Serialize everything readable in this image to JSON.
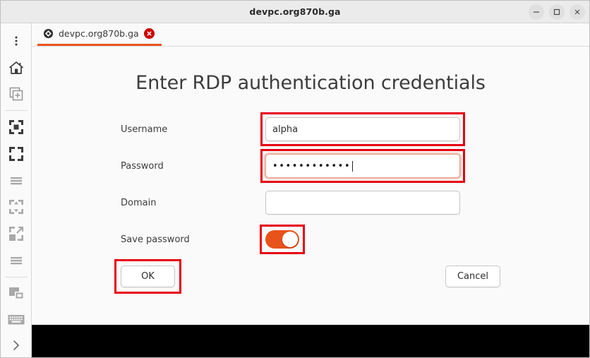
{
  "window": {
    "title": "devpc.org870b.ga",
    "controls": [
      {
        "name": "minimize",
        "glyph": "minimize-icon"
      },
      {
        "name": "maximize",
        "glyph": "maximize-icon"
      },
      {
        "name": "close",
        "glyph": "close-icon"
      }
    ]
  },
  "tabbar": {
    "tabs": [
      {
        "label": "devpc.org870b.ga",
        "favicon": "remote-desktop-icon",
        "close_label": "x",
        "active": true
      }
    ]
  },
  "sidebar": {
    "items": [
      {
        "name": "menu-kebab",
        "title": "Menu"
      },
      {
        "name": "home",
        "title": "Home"
      },
      {
        "name": "new-connection",
        "title": "New connection"
      },
      {
        "name": "fit-window",
        "title": "Fit window"
      },
      {
        "name": "fullscreen",
        "title": "Fullscreen"
      },
      {
        "name": "list-view-1",
        "title": "Options"
      },
      {
        "name": "scale-contents",
        "title": "Scale contents"
      },
      {
        "name": "resize-window",
        "title": "Resize window"
      },
      {
        "name": "list-view-2",
        "title": "Options"
      },
      {
        "name": "multi-monitor",
        "title": "Multi-monitor"
      },
      {
        "name": "keyboard",
        "title": "Keyboard"
      },
      {
        "name": "expand-arrow",
        "title": "Expand sidebar"
      }
    ]
  },
  "dialog": {
    "title": "Enter RDP authentication credentials",
    "fields": {
      "username": {
        "label": "Username",
        "value": "alpha",
        "placeholder": "",
        "highlighted": true
      },
      "password": {
        "label": "Password",
        "value": "••••••••••••",
        "masked_char": "•",
        "masked_length": 12,
        "placeholder": "",
        "focused": true,
        "highlighted": true
      },
      "domain": {
        "label": "Domain",
        "value": "",
        "placeholder": "",
        "highlighted": false
      },
      "save_password": {
        "label": "Save password",
        "state": "on",
        "highlighted": true
      }
    },
    "buttons": {
      "ok": {
        "label": "OK",
        "highlighted": true
      },
      "cancel": {
        "label": "Cancel",
        "highlighted": false
      }
    }
  },
  "colors": {
    "accent_orange": "#e95420",
    "toggle_on": "#e8531b",
    "highlight_red": "#e60012",
    "tab_close_red": "#cc0000",
    "window_bg": "#fafafa",
    "titlebar_bg": "#ebebeb",
    "terminal_black": "#000000"
  }
}
